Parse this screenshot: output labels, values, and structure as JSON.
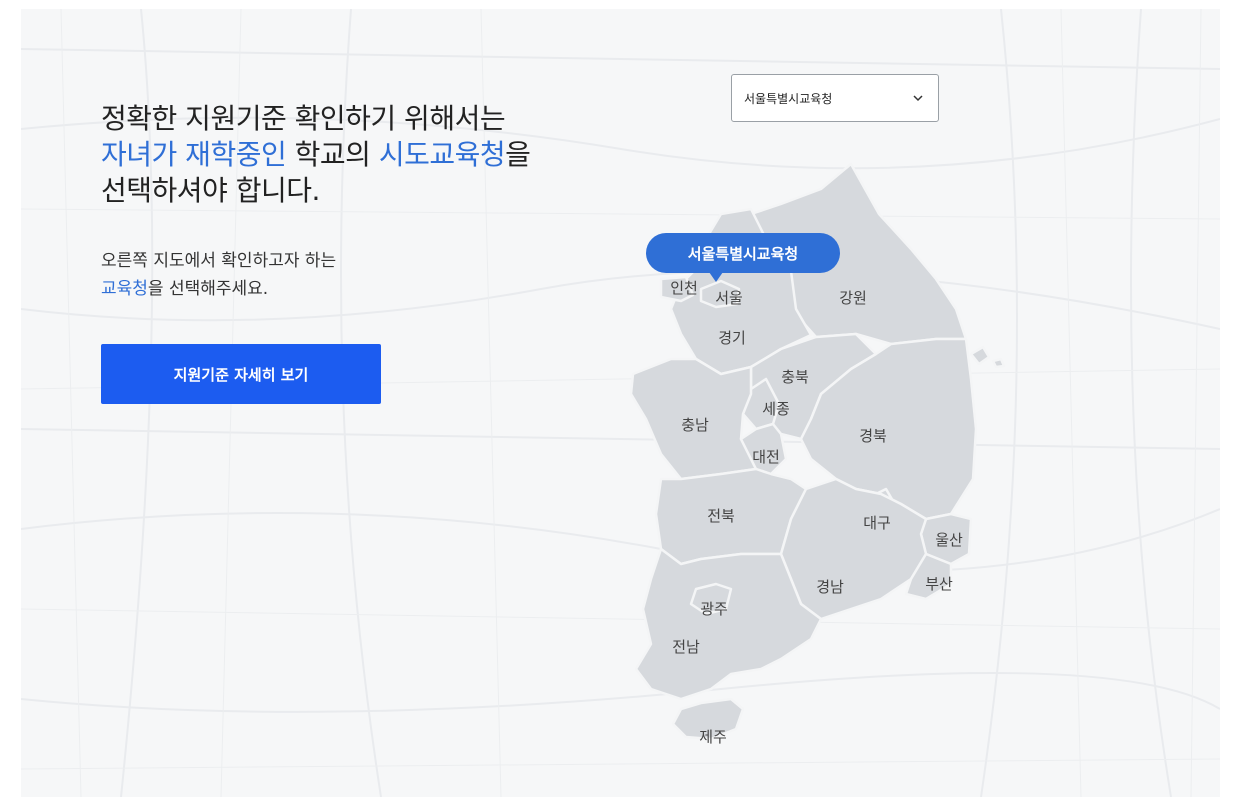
{
  "intro": {
    "line1": "정확한 지원기준 확인하기 위해서는",
    "line2_hl1": "자녀가 재학중인",
    "line2_mid": " 학교의 ",
    "line2_hl2": "시도교육청",
    "line2_end": "을",
    "line3": "선택하셔야 합니다."
  },
  "instruction": {
    "line1": "오른쪽 지도에서 확인하고자 하는",
    "hl": "교육청",
    "rest": "을 선택해주세요."
  },
  "cta_label": "지원기준 자세히 보기",
  "office_select": {
    "value": "서울특별시교육청",
    "icon": "chevron-down-icon"
  },
  "map": {
    "selected_callout": "서울특별시교육청",
    "regions": {
      "incheon": "인천",
      "seoul": "서울",
      "gangwon": "강원",
      "gyeonggi": "경기",
      "chungbuk": "충북",
      "sejong": "세종",
      "chungnam": "충남",
      "daejeon": "대전",
      "gyeongbuk": "경북",
      "jeonbuk": "전북",
      "daegu": "대구",
      "ulsan": "울산",
      "gyeongnam": "경남",
      "busan": "부산",
      "gwangju": "광주",
      "jeonnam": "전남",
      "jeju": "제주"
    }
  },
  "colors": {
    "accent": "#2f6fd6",
    "cta": "#1c5cf0",
    "region_fill": "#d6d9dd",
    "region_stroke": "#f4f5f6",
    "background": "#f6f7f8"
  }
}
